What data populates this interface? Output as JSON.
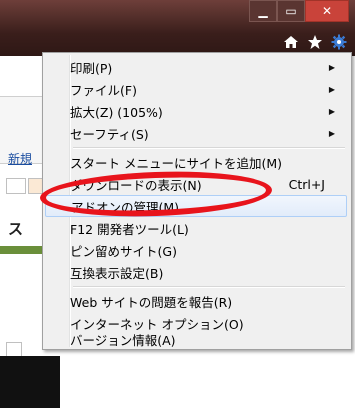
{
  "window": {
    "minimize_symbol": "▁",
    "maximize_symbol": "▭",
    "close_symbol": "✕"
  },
  "toolbar": {
    "icons": [
      "home-icon",
      "favorites-star-icon",
      "tools-gear-icon"
    ]
  },
  "page": {
    "link_text": "新規",
    "heading_text": "ス"
  },
  "menu": {
    "items": [
      {
        "label": "印刷(P)",
        "shortcut": "",
        "submenu": true
      },
      {
        "label": "ファイル(F)",
        "shortcut": "",
        "submenu": true
      },
      {
        "label": "拡大(Z) (105%)",
        "shortcut": "",
        "submenu": true
      },
      {
        "label": "セーフティ(S)",
        "shortcut": "",
        "submenu": true
      },
      {
        "label": "スタート メニューにサイトを追加(M)",
        "shortcut": "",
        "submenu": false
      },
      {
        "label": "ダウンロードの表示(N)",
        "shortcut": "Ctrl+J",
        "submenu": false
      },
      {
        "label": "アドオンの管理(M)",
        "shortcut": "",
        "submenu": false,
        "highlighted": true
      },
      {
        "label": "F12 開発者ツール(L)",
        "shortcut": "",
        "submenu": false
      },
      {
        "label": "ピン留めサイト(G)",
        "shortcut": "",
        "submenu": false
      },
      {
        "label": "互換表示設定(B)",
        "shortcut": "",
        "submenu": false
      },
      {
        "label": "Web サイトの問題を報告(R)",
        "shortcut": "",
        "submenu": false
      },
      {
        "label": "インターネット オプション(O)",
        "shortcut": "",
        "submenu": false
      },
      {
        "label": "バージョン情報(A)",
        "shortcut": "",
        "submenu": false
      }
    ]
  },
  "colors": {
    "annotation": "#e8141c",
    "close_button": "#c9433a",
    "toolbar_gear": "#3b7bd4"
  }
}
